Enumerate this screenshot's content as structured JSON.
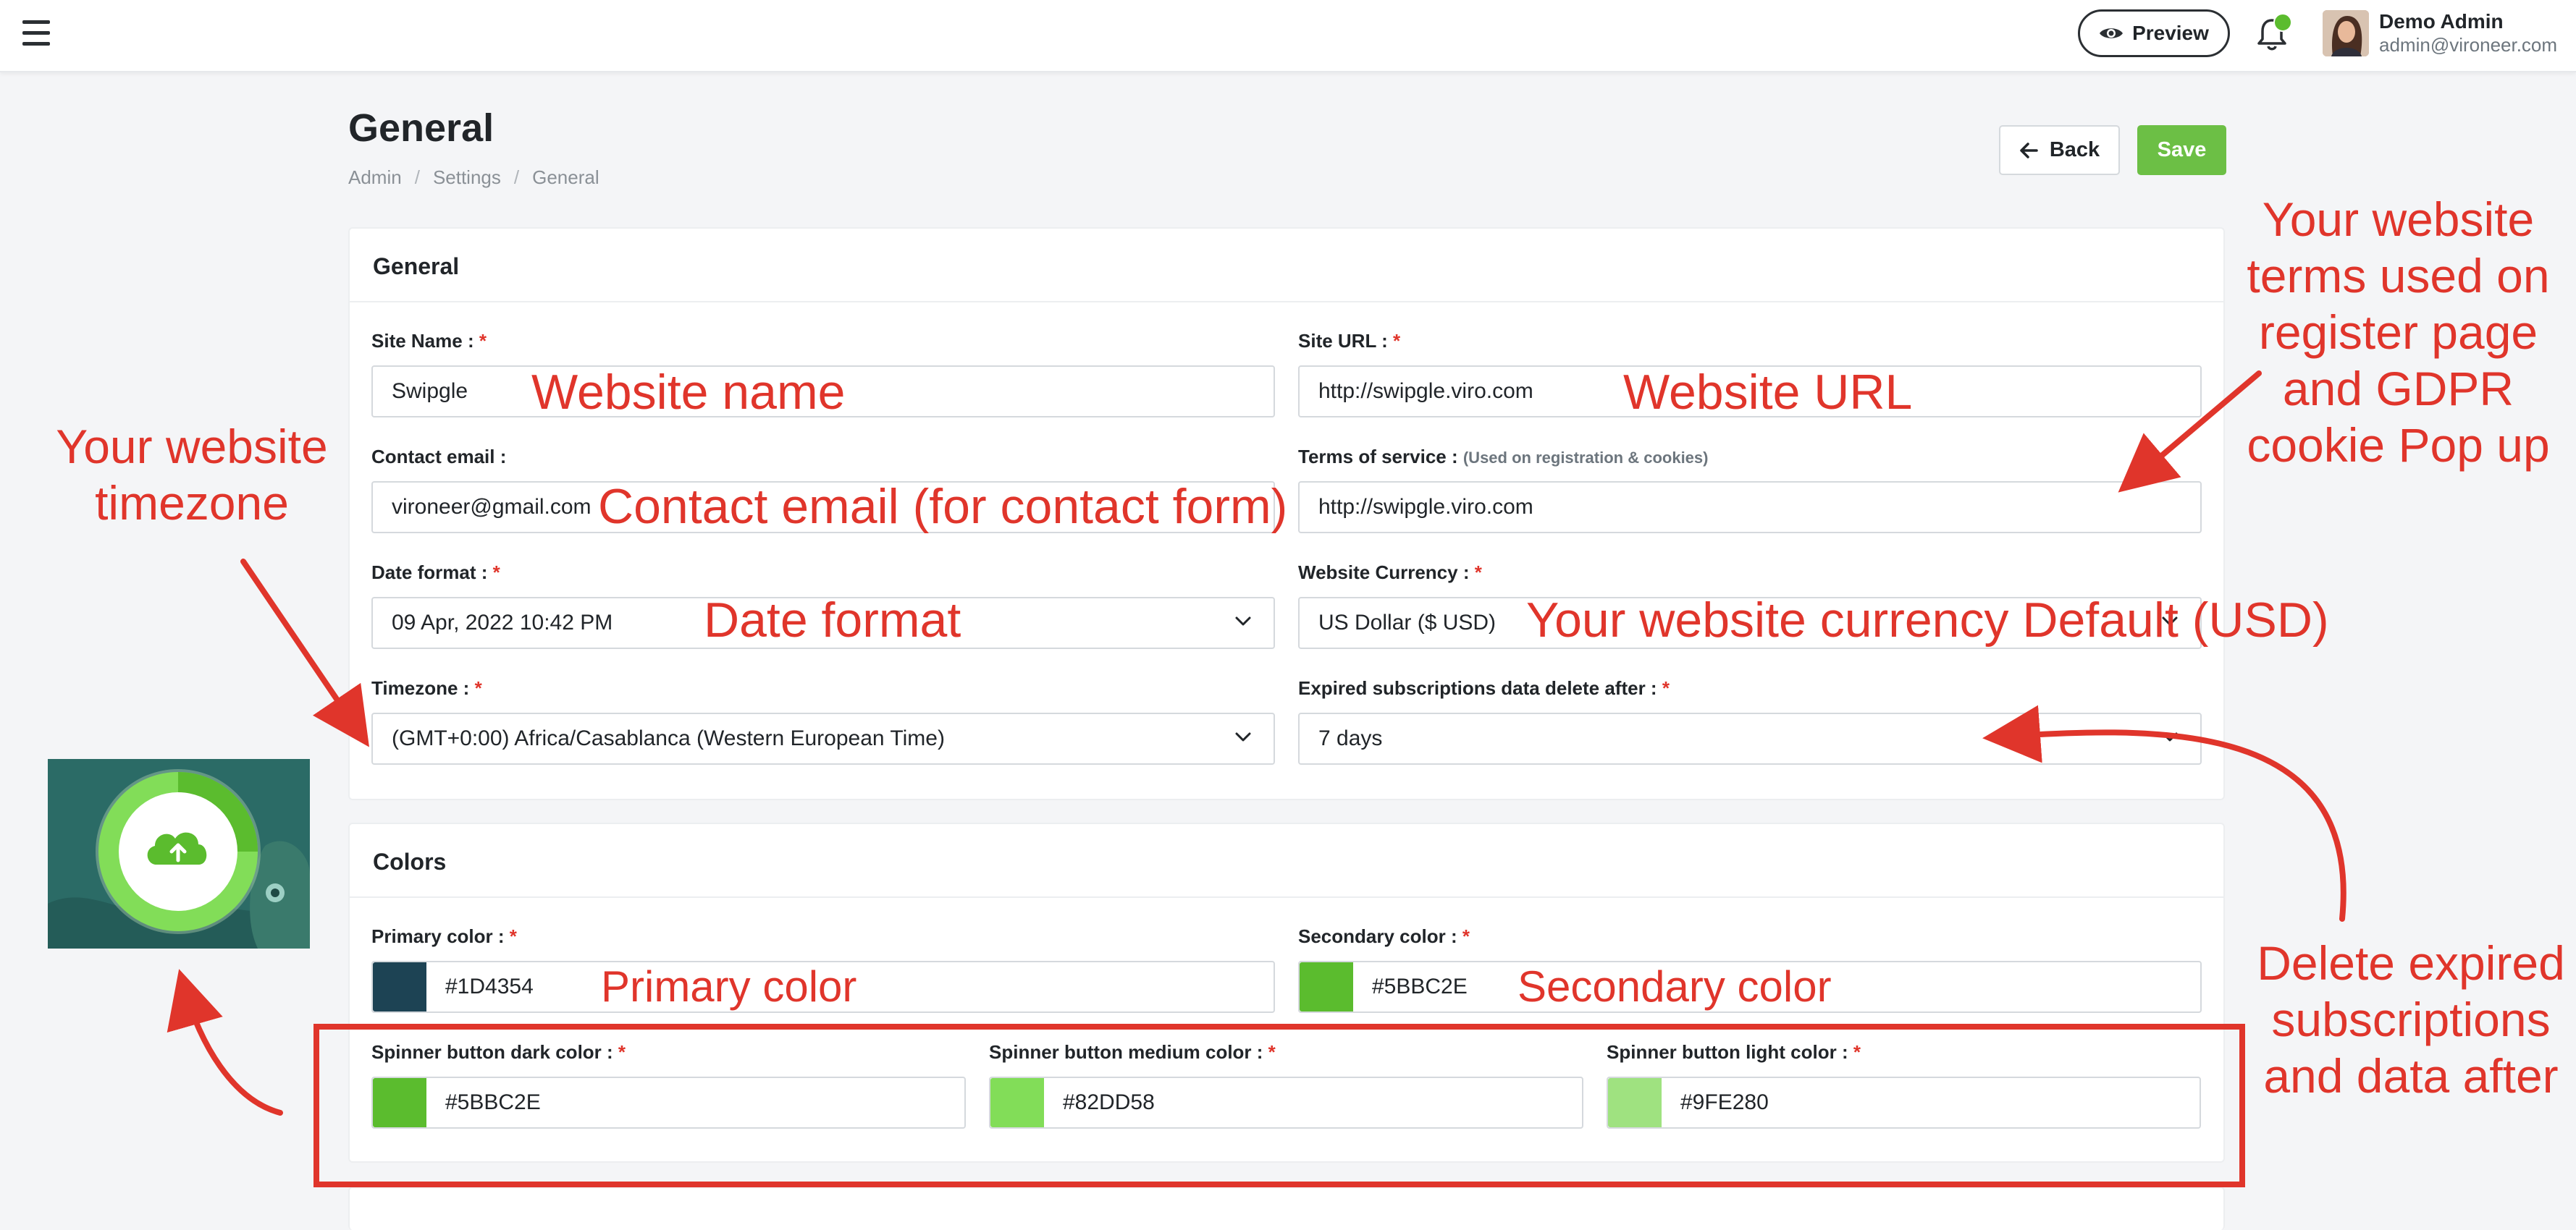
{
  "topbar": {
    "preview_label": "Preview",
    "user_name": "Demo Admin",
    "user_email": "admin@vironeer.com"
  },
  "page": {
    "title": "General",
    "breadcrumb": [
      "Admin",
      "Settings",
      "General"
    ],
    "back_label": "Back",
    "save_label": "Save"
  },
  "general": {
    "title": "General",
    "site_name": {
      "label": "Site Name :",
      "value": "Swipgle"
    },
    "site_url": {
      "label": "Site URL :",
      "value": "http://swipgle.viro.com"
    },
    "contact_email": {
      "label": "Contact email :",
      "value": "vironeer@gmail.com"
    },
    "terms": {
      "label": "Terms of service :",
      "hint": "(Used on registration & cookies)",
      "value": "http://swipgle.viro.com"
    },
    "date_format": {
      "label": "Date format :",
      "value": "09 Apr, 2022 10:42 PM"
    },
    "currency": {
      "label": "Website Currency :",
      "value": "US Dollar ($ USD)"
    },
    "timezone": {
      "label": "Timezone :",
      "value": "(GMT+0:00) Africa/Casablanca (Western European Time)"
    },
    "expired": {
      "label": "Expired subscriptions data delete after :",
      "value": "7 days"
    }
  },
  "colors": {
    "title": "Colors",
    "primary": {
      "label": "Primary color :",
      "value": "#1D4354",
      "swatch": "#1D4354"
    },
    "secondary": {
      "label": "Secondary color :",
      "value": "#5BBC2E",
      "swatch": "#5BBC2E"
    },
    "spinner_dark": {
      "label": "Spinner button dark color :",
      "value": "#5BBC2E",
      "swatch": "#5BBC2E"
    },
    "spinner_medium": {
      "label": "Spinner button medium color :",
      "value": "#82DD58",
      "swatch": "#82DD58"
    },
    "spinner_light": {
      "label": "Spinner button light color :",
      "value": "#9FE280",
      "swatch": "#9FE280"
    }
  },
  "annotations": {
    "website_name": "Website name",
    "website_url": "Website URL",
    "contact_email": "Contact email (for contact form)",
    "date_format": "Date format",
    "currency": "Your website currency Default (USD)",
    "primary_color": "Primary color",
    "secondary_color": "Secondary color",
    "timezone": "Your website timezone",
    "terms": "Your website terms used on register page and GDPR cookie Pop up",
    "delete_expired": "Delete expired subscriptions and data after"
  },
  "theme": {
    "accent": "#5bbc2e",
    "annotation": "#e0352b",
    "preview_bg": "#2b6b66"
  },
  "icons": [
    "menu-icon",
    "eye-icon",
    "bell-icon",
    "arrow-left-icon",
    "chevron-down-icon",
    "cloud-upload-icon"
  ]
}
